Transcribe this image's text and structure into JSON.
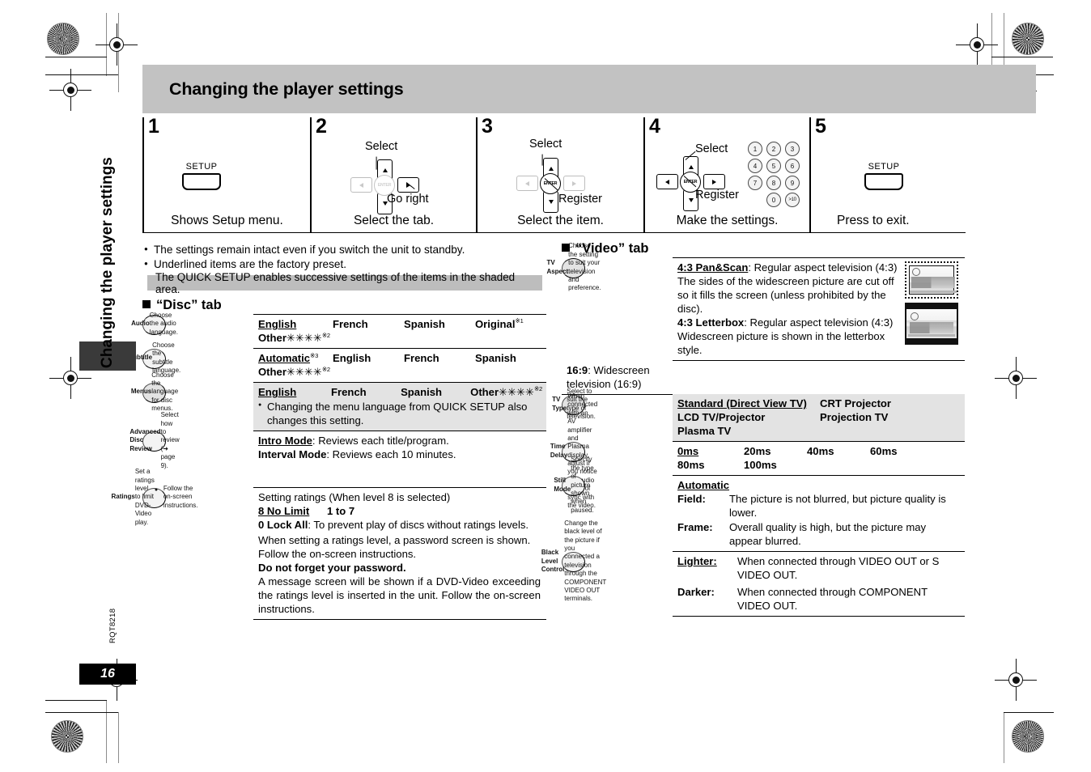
{
  "header": {
    "title": "Changing the player settings"
  },
  "sidebar": {
    "vertical_title": "Changing the player settings",
    "doc_code": "RQT8218",
    "page_number": "16"
  },
  "steps": [
    {
      "num": "1",
      "caption": "Shows Setup menu.",
      "button_label": "SETUP",
      "callouts": []
    },
    {
      "num": "2",
      "caption": "Select the tab.",
      "callouts": [
        "Select",
        "Go right"
      ]
    },
    {
      "num": "3",
      "caption": "Select the item.",
      "callouts": [
        "Select",
        "Register"
      ]
    },
    {
      "num": "4",
      "caption": "Make the settings.",
      "callouts": [
        "Select",
        "Register"
      ],
      "keypad": [
        "1",
        "2",
        "3",
        "4",
        "5",
        "6",
        "7",
        "8",
        "9",
        "0",
        ">10"
      ]
    },
    {
      "num": "5",
      "caption": "Press to exit.",
      "button_label": "SETUP",
      "callouts": []
    }
  ],
  "enter_label": "ENTER",
  "notes": [
    "The settings remain intact even if you switch the unit to standby.",
    "Underlined items are the factory preset."
  ],
  "quick_setup_bar": "The QUICK SETUP enables successive settings of the items in the shaded area.",
  "disc_tab": {
    "heading": "“Disc” tab",
    "rows": [
      {
        "title": "Audio",
        "desc": "Choose the audio language.",
        "options": [
          "English",
          "French",
          "Spanish",
          "Original"
        ],
        "original_sup": "※1",
        "other": "Other✳✳✳✳",
        "other_sup": "※2",
        "shaded": false
      },
      {
        "title": "Subtitle",
        "desc": "Choose the subtitle language.",
        "options": [
          "Automatic",
          "English",
          "French",
          "Spanish"
        ],
        "automatic_sup": "※3",
        "other": "Other✳✳✳✳",
        "other_sup": "※2",
        "shaded": false
      },
      {
        "title": "Menus",
        "desc": "Choose the language for disc menus.",
        "options": [
          "English",
          "French",
          "Spanish",
          "Other✳✳✳✳"
        ],
        "other_sup": "※2",
        "note": "Changing the menu language from QUICK SETUP also changes this setting.",
        "shaded": true
      },
      {
        "title": "Advanced Disc Review",
        "desc": "Select how to review (➜ page 9).",
        "lines": [
          {
            "term": "Intro Mode",
            "underline": true,
            "text": ": Reviews each title/program."
          },
          {
            "term": "Interval Mode",
            "underline": false,
            "text": ": Reviews each 10 minutes."
          }
        ],
        "shaded": false
      },
      {
        "title": "Ratings",
        "desc": "Set a ratings level to limit DVD-Video play.",
        "bullet": "Follow the on-screen instructions.",
        "body_line1": "Setting ratings (When level 8 is selected)",
        "level_default": "8 No Limit",
        "level_range": "1 to 7",
        "lock_all": "0 Lock All",
        "lock_all_text": ": To prevent play of discs without ratings levels.",
        "body_line2": "When setting a ratings level, a password screen is shown. Follow the on-screen instructions.",
        "warning": "Do not forget your password.",
        "body_line3": "A message screen will be shown if a DVD-Video exceeding the ratings level is inserted in the unit. Follow the on-screen instructions.",
        "shaded": false
      }
    ]
  },
  "video_tab": {
    "heading": "“Video” tab",
    "rows": [
      {
        "title": "TV Aspect",
        "desc": "Choose the setting to suit your television and preference.",
        "panscan_term": "4:3 Pan&Scan",
        "panscan_text": ": Regular aspect television (4:3) The sides of the widescreen picture are cut off so it fills the screen (unless prohibited by the disc).",
        "letterbox_term": "4:3 Letterbox",
        "letterbox_text": ": Regular aspect television (4:3) Widescreen picture is shown in the letterbox style.",
        "sub_term": "16:9",
        "sub_text": ": Widescreen television (16:9)",
        "shaded": "key-only"
      },
      {
        "title": "TV Type",
        "desc": "Select to suit the type of television.",
        "options": [
          "Standard (Direct View TV)",
          "CRT Projector",
          "LCD TV/Projector",
          "Projection TV",
          "Plasma TV"
        ],
        "shaded": true
      },
      {
        "title": "Time Delay",
        "desc": "When connected with an AV amplifier and Plasma display, adjust if you notice the audio is out of sync with the video.",
        "options": [
          "0ms",
          "20ms",
          "40ms",
          "60ms",
          "80ms",
          "100ms"
        ],
        "shaded": false
      },
      {
        "title": "Still Mode",
        "desc": "Specify the type of picture shown when paused.",
        "default_option": "Automatic",
        "defs": [
          {
            "term": "Field:",
            "text": "The picture is not blurred, but picture quality is lower."
          },
          {
            "term": "Frame:",
            "text": "Overall quality is high, but the picture may appear blurred."
          }
        ],
        "shaded": false
      },
      {
        "title": "Black Level Control",
        "desc": "Change the black level of the picture if you connected a television through the COMPONENT VIDEO OUT terminals.",
        "defs": [
          {
            "term": "Lighter:",
            "underline": true,
            "text": "When connected through VIDEO OUT or S VIDEO OUT."
          },
          {
            "term": "Darker:",
            "underline": false,
            "text": "When connected through COMPONENT VIDEO OUT."
          }
        ],
        "shaded": false
      }
    ]
  },
  "colors": {
    "header_bar": "#c2c2c2",
    "quick_bar": "#bdbdbd",
    "shade": "#e3e3e3",
    "page_box": "#000000"
  }
}
